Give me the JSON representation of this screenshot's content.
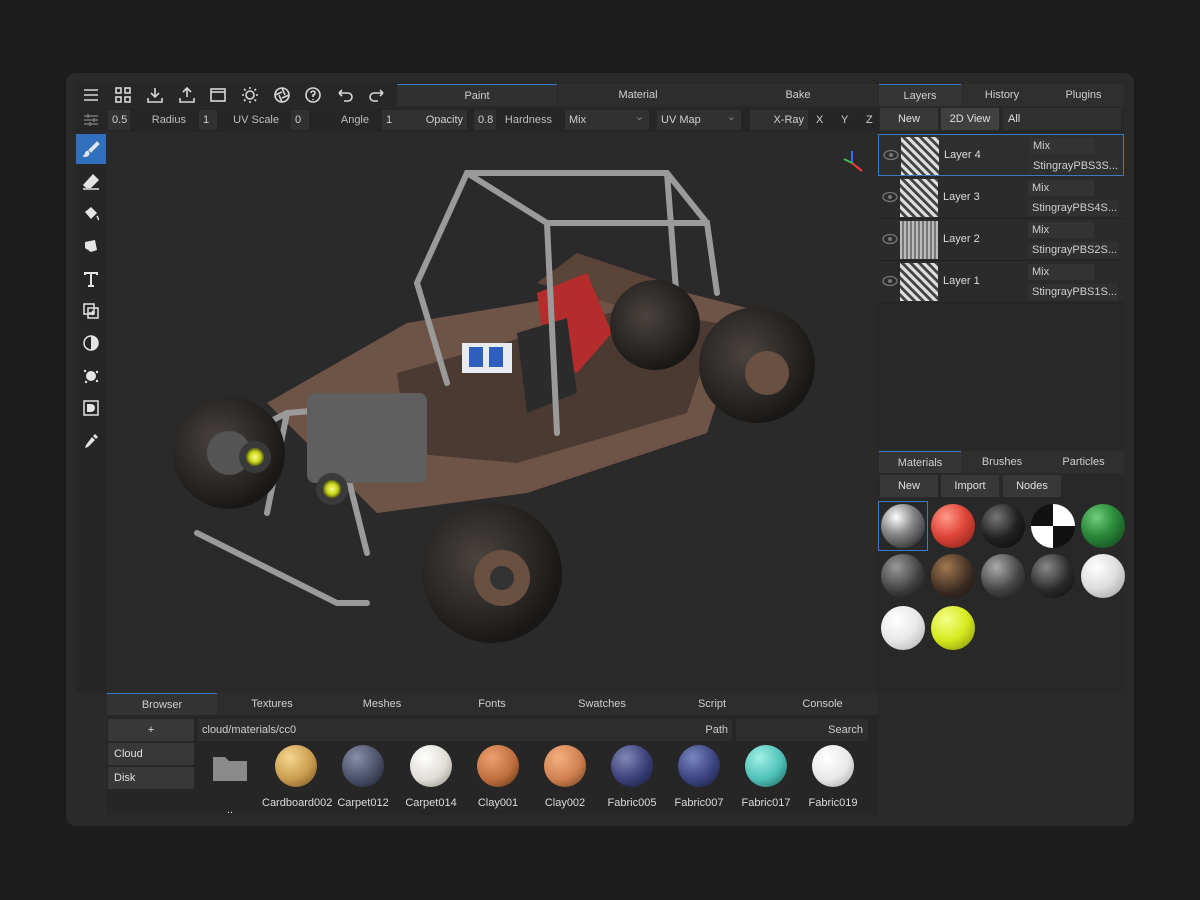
{
  "toolbar": {
    "mode_tabs": [
      "Paint",
      "Material",
      "Bake"
    ],
    "active_mode": "Paint"
  },
  "options": {
    "radius_value": "0.5",
    "radius_label": "Radius",
    "uvscale_value": "1",
    "uvscale_label": "UV Scale",
    "angle_value": "0",
    "angle_label": "Angle",
    "opacity_value": "1",
    "opacity_label": "Opacity",
    "hardness_value": "0.8",
    "hardness_label": "Hardness",
    "blend_mode": "Mix",
    "uv_mode": "UV Map",
    "xray_label": "X-Ray",
    "axis_x": "X",
    "axis_y": "Y",
    "axis_z": "Z"
  },
  "right_panel": {
    "tabs": [
      "Layers",
      "History",
      "Plugins"
    ],
    "active_tab": "Layers",
    "new_label": "New",
    "view_label": "2D View",
    "filter_label": "All",
    "layers": [
      {
        "name": "Layer 4",
        "mode": "Mix",
        "material": "StingrayPBS3S..."
      },
      {
        "name": "Layer 3",
        "mode": "Mix",
        "material": "StingrayPBS4S..."
      },
      {
        "name": "Layer 2",
        "mode": "Mix",
        "material": "StingrayPBS2S..."
      },
      {
        "name": "Layer 1",
        "mode": "Mix",
        "material": "StingrayPBS1S..."
      }
    ]
  },
  "materials_panel": {
    "tabs": [
      "Materials",
      "Brushes",
      "Particles"
    ],
    "active_tab": "Materials",
    "buttons": [
      "New",
      "Import",
      "Nodes"
    ]
  },
  "browser": {
    "tabs": [
      "Browser",
      "Textures",
      "Meshes",
      "Fonts",
      "Swatches",
      "Script",
      "Console"
    ],
    "active_tab": "Browser",
    "add_label": "+",
    "path": "cloud/materials/cc0",
    "path_label": "Path",
    "search_label": "Search",
    "locations": [
      "Cloud",
      "Disk"
    ],
    "up_label": "..",
    "items": [
      "Cardboard002",
      "Carpet012",
      "Carpet014",
      "Clay001",
      "Clay002",
      "Fabric005",
      "Fabric007",
      "Fabric017",
      "Fabric019"
    ]
  }
}
